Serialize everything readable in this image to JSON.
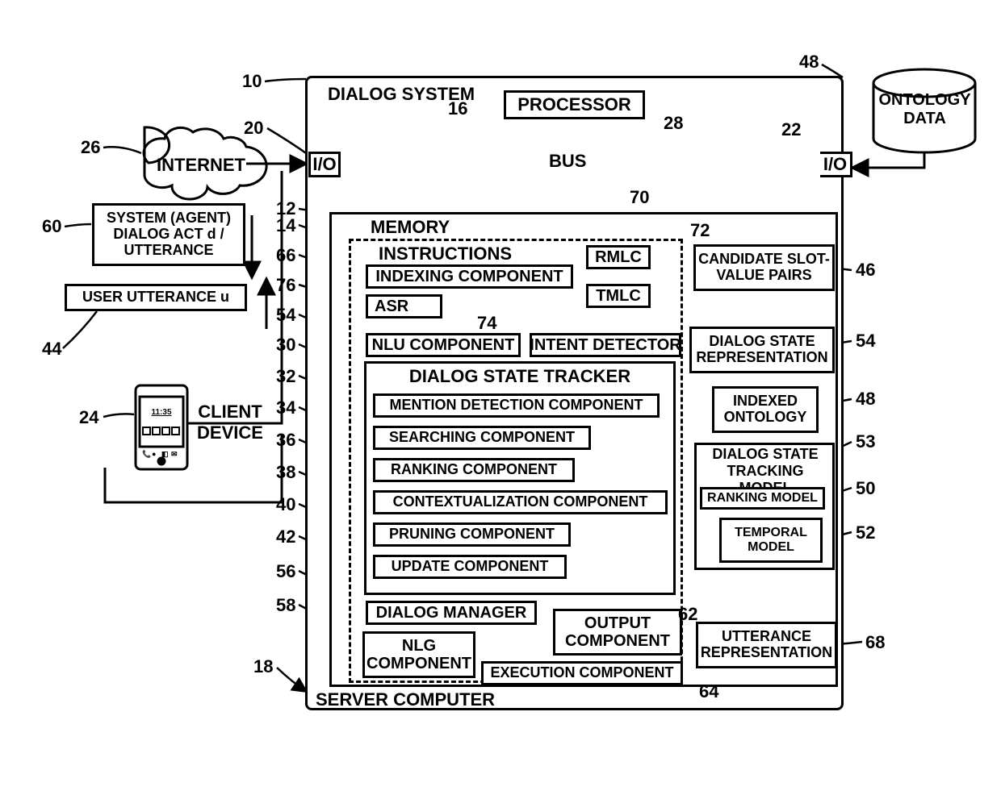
{
  "title": "DIALOG SYSTEM",
  "server": "SERVER COMPUTER",
  "processor": "PROCESSOR",
  "bus": "BUS",
  "io": "I/O",
  "internet": "INTERNET",
  "ontology_data": "ONTOLOGY DATA",
  "client_device": "CLIENT DEVICE",
  "system_agent": "SYSTEM (AGENT) DIALOG ACT d / UTTERANCE",
  "user_utterance": "USER UTTERANCE u",
  "memory": "MEMORY",
  "instructions": "INSTRUCTIONS",
  "indexing_component": "INDEXING COMPONENT",
  "asr": "ASR",
  "nlu_component": "NLU COMPONENT",
  "intent_detector": "INTENT DETECTOR",
  "rmlc": "RMLC",
  "tmlc": "TMLC",
  "dst": "DIALOG STATE TRACKER",
  "mention_detection": "MENTION DETECTION COMPONENT",
  "searching_component": "SEARCHING COMPONENT",
  "ranking_component": "RANKING COMPONENT",
  "contextualization_component": "CONTEXTUALIZATION COMPONENT",
  "pruning_component": "PRUNING COMPONENT",
  "update_component": "UPDATE COMPONENT",
  "dialog_manager": "DIALOG MANAGER",
  "nlg_component": "NLG COMPONENT",
  "output_component": "OUTPUT COMPONENT",
  "execution_component": "EXECUTION COMPONENT",
  "candidate_slot": "CANDIDATE SLOT-VALUE PAIRS",
  "dialog_state_repr": "DIALOG STATE REPRESENTATION",
  "indexed_ontology": "INDEXED ONTOLOGY",
  "dst_model": "DIALOG STATE TRACKING MODEL",
  "ranking_model": "RANKING MODEL",
  "temporal_model": "TEMPORAL MODEL",
  "utterance_repr": "UTTERANCE REPRESENTATION",
  "refs": {
    "r10": "10",
    "r12": "12",
    "r14": "14",
    "r16": "16",
    "r18": "18",
    "r20": "20",
    "r22": "22",
    "r24": "24",
    "r26": "26",
    "r28": "28",
    "r30": "30",
    "r32": "32",
    "r34": "34",
    "r36": "36",
    "r38": "38",
    "r40": "40",
    "r42": "42",
    "r44": "44",
    "r46": "46",
    "r48a": "48",
    "r48b": "48",
    "r50": "50",
    "r52": "52",
    "r53": "53",
    "r54a": "54",
    "r54b": "54",
    "r56": "56",
    "r58": "58",
    "r60": "60",
    "r62": "62",
    "r64": "64",
    "r66": "66",
    "r68": "68",
    "r70": "70",
    "r72": "72",
    "r74": "74",
    "r76": "76"
  }
}
